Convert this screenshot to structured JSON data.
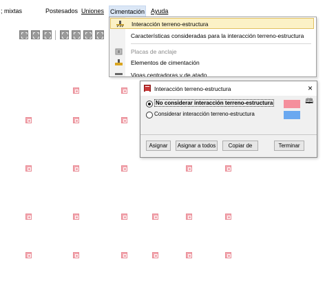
{
  "menubar": {
    "items": [
      "; mixtas",
      "Postesados",
      "Uniones",
      "Cimentación",
      "Ayuda"
    ]
  },
  "toolbar_icons": [
    "grid-icon",
    "grid-icon",
    "grid-icon",
    "grid-icon",
    "grid-icon",
    "grid-icon",
    "grid-icon"
  ],
  "dropdown": {
    "items": [
      {
        "label": "Interacción terreno-estructura",
        "icon": "ground-icon",
        "state": "selected"
      },
      {
        "label": "Características consideradas para la interacción terreno-estructura",
        "icon": "",
        "state": "normal"
      },
      {
        "label": "Placas de anclaje",
        "icon": "plate-icon",
        "state": "disabled"
      },
      {
        "label": "Elementos de cimentación",
        "icon": "foundation-icon",
        "state": "normal"
      },
      {
        "label": "Vigas centradoras y de atado",
        "icon": "beam-icon",
        "state": "partial"
      }
    ]
  },
  "dialog": {
    "title": "Interacción terreno-estructura",
    "close": "×",
    "options": [
      {
        "label": "No considerar interacción terreno-estructura",
        "selected": true,
        "color": "#f58f9c"
      },
      {
        "label": "Considerar interacción terreno-estructura",
        "selected": false,
        "color": "#6aa8f0"
      }
    ],
    "buttons": [
      "Asignar",
      "Asignar a todos",
      "Copiar de",
      "Terminar"
    ],
    "help_icon": "book-icon"
  },
  "grid_color": "#f2a8b0"
}
